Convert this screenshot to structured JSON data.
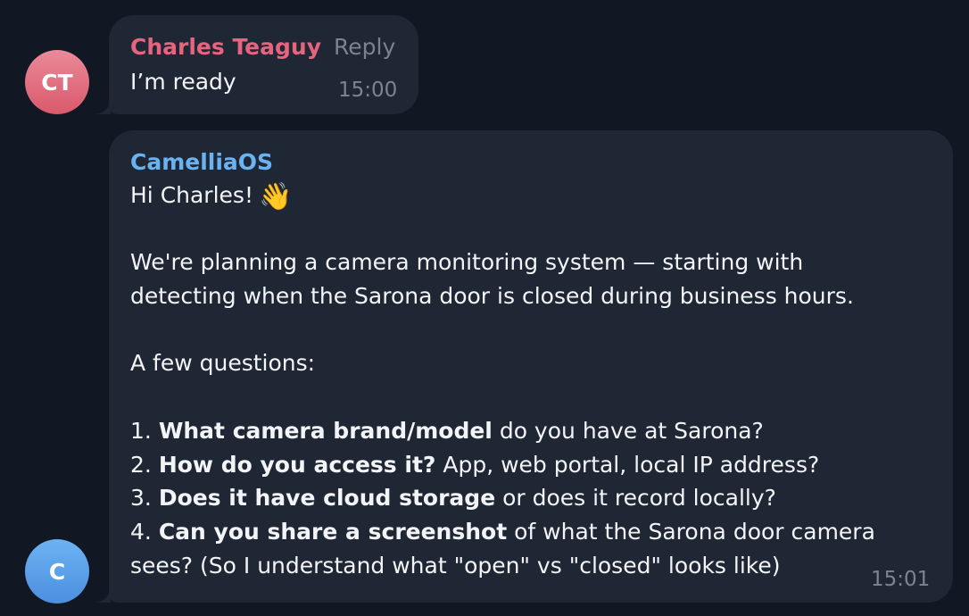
{
  "messages": [
    {
      "avatar_initials": "CT",
      "avatar_color": "#e07080",
      "sender": "Charles Teaguy",
      "sender_color": "#e5657f",
      "reply_label": "Reply",
      "text": "I’m ready",
      "time": "15:00"
    },
    {
      "avatar_initials": "C",
      "avatar_color": "#5a9ee8",
      "sender": "CamelliaOS",
      "sender_color": "#6bb3f0",
      "greeting": "Hi Charles!",
      "greeting_emoji": "👋",
      "intro": [
        "We're planning a camera monitoring system — starting with",
        "detecting when the Sarona door is closed during business hours."
      ],
      "questions_header": "A few questions:",
      "questions": [
        {
          "num": "1.",
          "bold": "What camera brand/model",
          "rest": " do you have at Sarona?"
        },
        {
          "num": "2.",
          "bold": "How do you access it?",
          "rest": " App, web portal, local IP address?"
        },
        {
          "num": "3.",
          "bold": "Does it have cloud storage",
          "rest": " or does it record locally?"
        },
        {
          "num": "4.",
          "bold": "Can you share a screenshot",
          "rest": " of what the Sarona door camera"
        }
      ],
      "questions_tail": "sees? (So I understand what \"open\" vs \"closed\" looks like)",
      "time": "15:01"
    }
  ],
  "colors": {
    "background": "#111823",
    "bubble": "#1e2733",
    "text": "#f2f4f7",
    "meta": "#7b8591"
  }
}
